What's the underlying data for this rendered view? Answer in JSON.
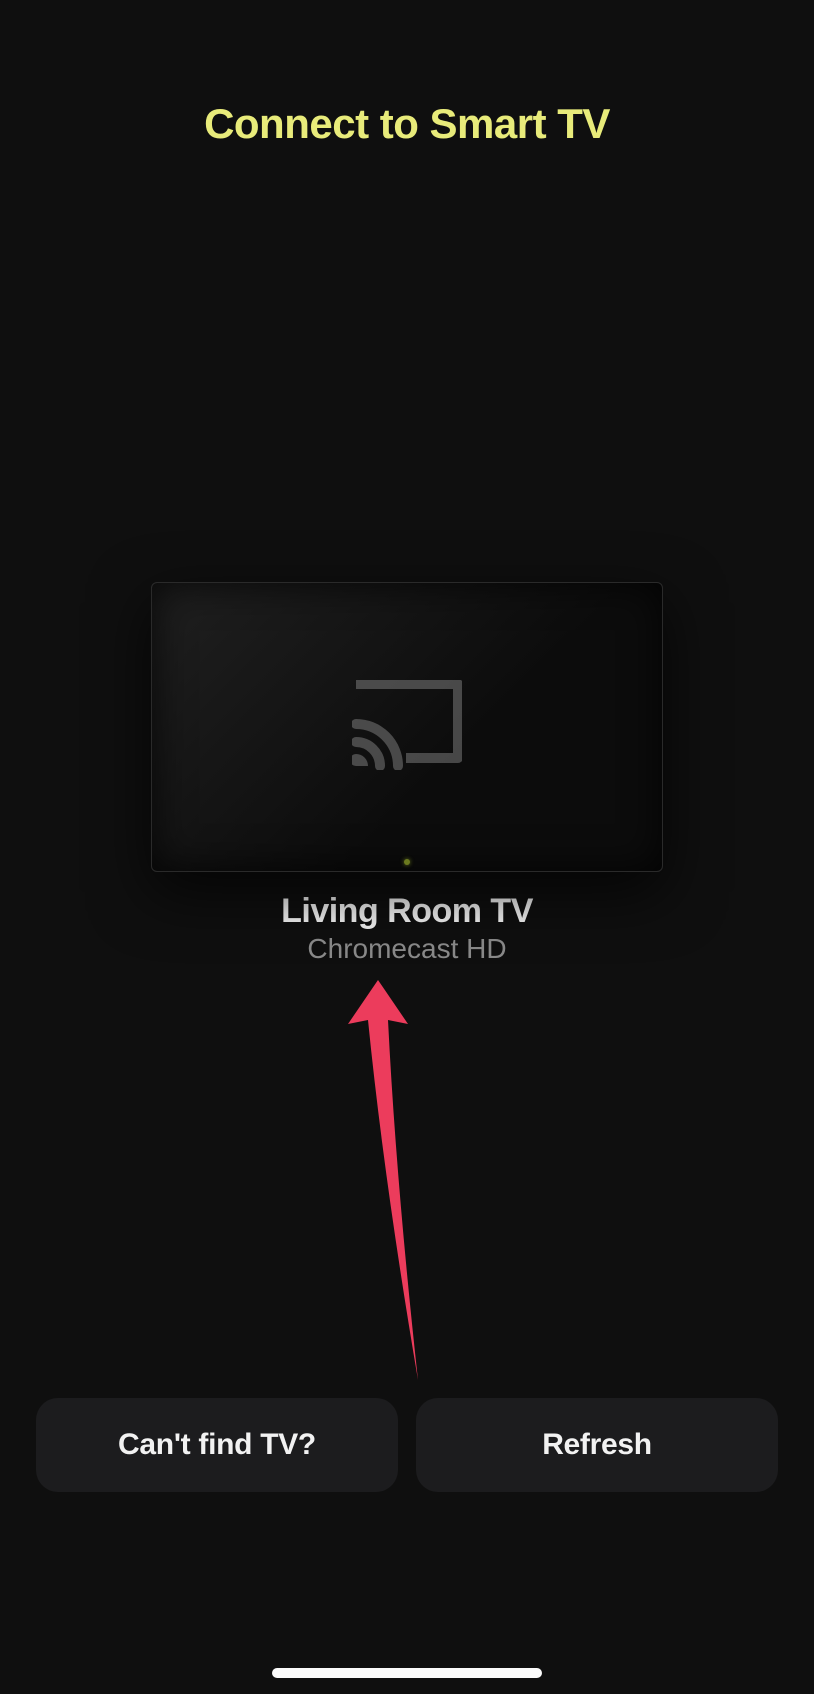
{
  "header": {
    "title": "Connect to Smart TV"
  },
  "device": {
    "name": "Living Room TV",
    "type": "Chromecast HD",
    "icon": "cast-icon"
  },
  "footer": {
    "help_label": "Can't find TV?",
    "refresh_label": "Refresh"
  },
  "colors": {
    "accent": "#e8eb7a",
    "annotation_arrow": "#ec3c5c"
  }
}
